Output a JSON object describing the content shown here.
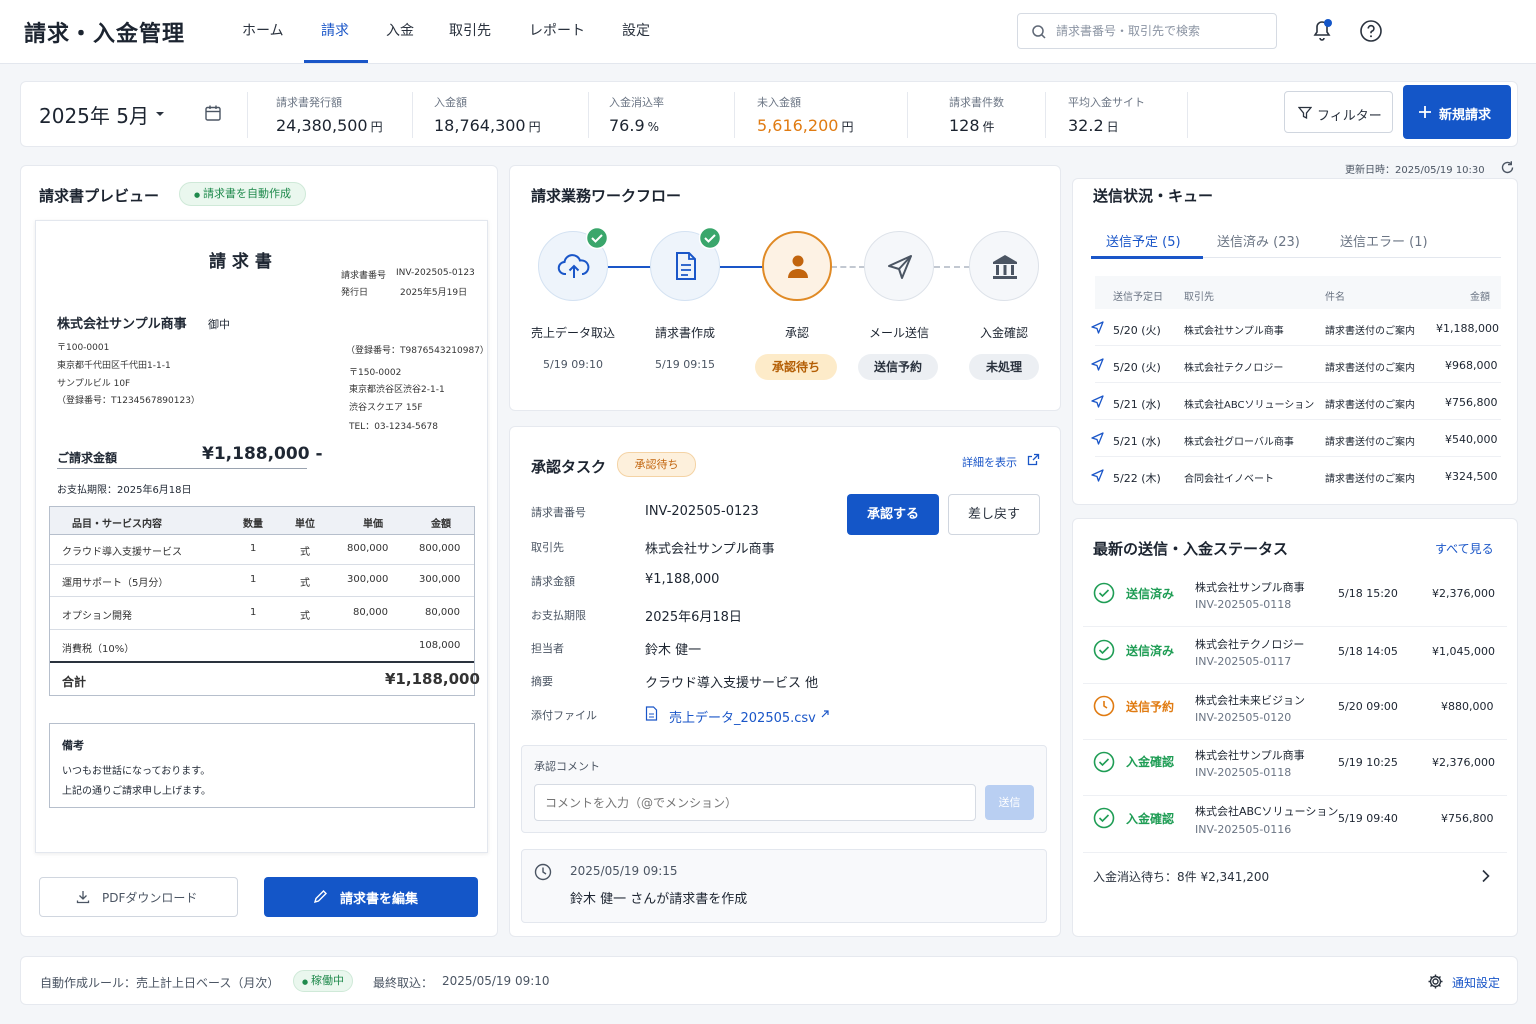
{
  "header": {
    "title": "請求・入金管理",
    "nav": [
      "ホーム",
      "請求",
      "入金",
      "取引先",
      "レポート",
      "設定"
    ],
    "active_nav": "請求",
    "search_placeholder": "請求書番号・取引先で検索"
  },
  "stats": {
    "month": "2025年 5月",
    "items": [
      {
        "label": "請求書発行額",
        "value": "24,380,500",
        "unit": "円"
      },
      {
        "label": "入金額",
        "value": "18,764,300",
        "unit": "円"
      },
      {
        "label": "入金消込率",
        "value": "76.9",
        "unit": "%"
      },
      {
        "label": "未入金額",
        "value": "5,616,200",
        "unit": "円"
      },
      {
        "label": "請求書件数",
        "value": "128",
        "unit": "件"
      },
      {
        "label": "平均入金サイト",
        "value": "32.2",
        "unit": "日"
      }
    ],
    "filter_label": "フィルター",
    "new_label": "新規請求"
  },
  "preview": {
    "title": "請求書プレビュー",
    "badge": "請求書を自動作成",
    "invoice": {
      "doc_title": "請 求 書",
      "no_label": "請求書番号",
      "no_value": "INV-202505-0123",
      "date_label": "発行日",
      "date_value": "2025年5月19日",
      "customer": "株式会社サンプル商事",
      "honorific": "御中",
      "cust_addr": [
        "〒100-0001",
        "東京都千代田区千代田1-1-1",
        "サンプルビル 10F",
        "（登録番号：T1234567890123）"
      ],
      "issuer_reg": "（登録番号：T9876543210987）",
      "issuer_addr": [
        "〒150-0002",
        "東京都渋谷区渋谷2-1-1",
        "渋谷スクエア 15F",
        "TEL：03-1234-5678"
      ],
      "amount_label": "ご請求金額",
      "amount_value": "¥1,188,000 -",
      "due": "お支払期限：2025年6月18日",
      "table_headers": [
        "品目・サービス内容",
        "数量",
        "単位",
        "単価",
        "金額"
      ],
      "rows": [
        [
          "クラウド導入支援サービス",
          "1",
          "式",
          "800,000",
          "800,000"
        ],
        [
          "運用サポート（5月分）",
          "1",
          "式",
          "300,000",
          "300,000"
        ],
        [
          "オプション開発",
          "1",
          "式",
          "80,000",
          "80,000"
        ]
      ],
      "tax_label": "消費税（10%）",
      "tax_value": "108,000",
      "total_label": "合計",
      "total_value": "¥1,188,000",
      "notes_title": "備考",
      "notes": [
        "いつもお世話になっております。",
        "上記の通りご請求申し上げます。"
      ]
    },
    "pdf_label": "PDFダウンロード",
    "edit_label": "請求書を編集"
  },
  "workflow": {
    "title": "請求業務ワークフロー",
    "steps": [
      {
        "label": "売上データ取込",
        "time": "5/19 09:10",
        "badge": "",
        "icon": "cloud-upload-icon",
        "done": true
      },
      {
        "label": "請求書作成",
        "time": "5/19 09:15",
        "badge": "",
        "icon": "document-icon",
        "done": true
      },
      {
        "label": "承認",
        "time": "",
        "badge": "承認待ち",
        "icon": "user-icon",
        "done": false
      },
      {
        "label": "メール送信",
        "time": "",
        "badge": "送信予約",
        "icon": "send-icon",
        "done": false
      },
      {
        "label": "入金確認",
        "time": "",
        "badge": "未処理",
        "icon": "bank-icon",
        "done": false
      }
    ]
  },
  "approval": {
    "title": "承認タスク",
    "badge": "承認待ち",
    "detail_link": "詳細を表示",
    "fields": [
      {
        "label": "請求書番号",
        "value": "INV-202505-0123"
      },
      {
        "label": "取引先",
        "value": "株式会社サンプル商事"
      },
      {
        "label": "請求金額",
        "value": "¥1,188,000"
      },
      {
        "label": "お支払期限",
        "value": "2025年6月18日"
      },
      {
        "label": "担当者",
        "value": "鈴木 健一"
      },
      {
        "label": "摘要",
        "value": "クラウド導入支援サービス 他"
      },
      {
        "label": "添付ファイル",
        "value": "売上データ_202505.csv"
      }
    ],
    "approve_label": "承認する",
    "reject_label": "差し戻す",
    "comment_label": "承認コメント",
    "comment_placeholder": "コメントを入力（@でメンション）",
    "send_label": "送信",
    "log_time": "2025/05/19 09:15",
    "log_text": "鈴木 健一 さんが請求書を作成"
  },
  "queue": {
    "updated": "更新日時：2025/05/19 10:30",
    "title": "送信状況・キュー",
    "tabs": [
      "送信予定 (5)",
      "送信済み (23)",
      "送信エラー (1)"
    ],
    "headers": [
      "送信予定日",
      "取引先",
      "件名",
      "金額"
    ],
    "rows": [
      [
        "5/20 (火)",
        "株式会社サンプル商事",
        "請求書送付のご案内",
        "¥1,188,000"
      ],
      [
        "5/20 (火)",
        "株式会社テクノロジー",
        "請求書送付のご案内",
        "¥968,000"
      ],
      [
        "5/21 (水)",
        "株式会社ABCソリューション",
        "請求書送付のご案内",
        "¥756,800"
      ],
      [
        "5/21 (水)",
        "株式会社グローバル商事",
        "請求書送付のご案内",
        "¥540,000"
      ],
      [
        "5/22 (木)",
        "合同会社イノベート",
        "請求書送付のご案内",
        "¥324,500"
      ]
    ]
  },
  "status": {
    "title": "最新の送信・入金ステータス",
    "see_all": "すべて見る",
    "items": [
      {
        "state": "送信済み",
        "kind": "ok",
        "company": "株式会社サンプル商事",
        "invoice": "INV-202505-0118",
        "time": "5/18 15:20",
        "amount": "¥2,376,000"
      },
      {
        "state": "送信済み",
        "kind": "ok",
        "company": "株式会社テクノロジー",
        "invoice": "INV-202505-0117",
        "time": "5/18 14:05",
        "amount": "¥1,045,000"
      },
      {
        "state": "送信予約",
        "kind": "pending",
        "company": "株式会社未来ビジョン",
        "invoice": "INV-202505-0120",
        "time": "5/20 09:00",
        "amount": "¥880,000"
      },
      {
        "state": "入金確認",
        "kind": "ok",
        "company": "株式会社サンプル商事",
        "invoice": "INV-202505-0118",
        "time": "5/19 10:25",
        "amount": "¥2,376,000"
      },
      {
        "state": "入金確認",
        "kind": "ok",
        "company": "株式会社ABCソリューション",
        "invoice": "INV-202505-0116",
        "time": "5/19 09:40",
        "amount": "¥756,800"
      }
    ],
    "footer": "入金消込待ち：8件 ¥2,341,200"
  },
  "footer": {
    "rule": "自動作成ルール：売上計上日ベース（月次）",
    "rule_status": "稼働中",
    "last_import_label": "最終取込：",
    "last_import_value": "2025/05/19 09:10",
    "notify_label": "通知設定"
  },
  "colors": {
    "primary": "#1456c8",
    "success": "#1f9d55",
    "warning": "#e07b12",
    "danger_text": "#e07b12"
  }
}
